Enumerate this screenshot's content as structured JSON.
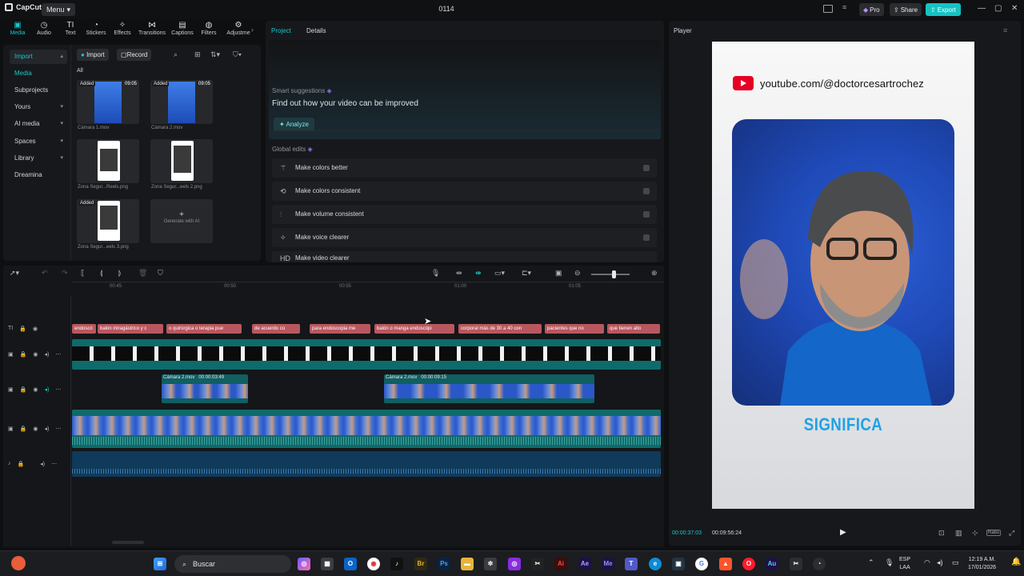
{
  "titlebar": {
    "app_name": "CapCut",
    "menu_label": "Menu",
    "project_title": "0114",
    "pro_label": "Pro",
    "share_label": "Share",
    "export_label": "Export"
  },
  "toolbar": {
    "tools": [
      {
        "label": "Media",
        "icon": "media-icon",
        "active": true
      },
      {
        "label": "Audio",
        "icon": "audio-icon"
      },
      {
        "label": "Text",
        "icon": "text-icon"
      },
      {
        "label": "Stickers",
        "icon": "stickers-icon"
      },
      {
        "label": "Effects",
        "icon": "effects-icon"
      },
      {
        "label": "Transitions",
        "icon": "transitions-icon"
      },
      {
        "label": "Captions",
        "icon": "captions-icon"
      },
      {
        "label": "Filters",
        "icon": "filters-icon"
      },
      {
        "label": "Adjustme",
        "icon": "adjustment-icon"
      }
    ]
  },
  "sidebar": {
    "items": [
      {
        "label": "Import",
        "selected": true,
        "chevron": true
      },
      {
        "label": "Media",
        "accent": true
      },
      {
        "label": "Subprojects"
      },
      {
        "label": "Yours",
        "chevron": true
      },
      {
        "label": "AI media",
        "chevron": true
      },
      {
        "label": "Spaces",
        "chevron": true
      },
      {
        "label": "Library",
        "chevron": true
      },
      {
        "label": "Dreamina"
      }
    ]
  },
  "media": {
    "import_label": "Import",
    "record_label": "Record",
    "filter_all": "All",
    "items": [
      {
        "name": "Cámara 1.mov",
        "badge": "Added",
        "duration": "09:05"
      },
      {
        "name": "Cámara 2.mov",
        "badge": "Added",
        "duration": "09:05"
      },
      {
        "name": "Zona Segur...Reels.png",
        "badge": ""
      },
      {
        "name": "Zona Segur...eels 2.png",
        "badge": ""
      },
      {
        "name": "Zona Segur...eels 3.png",
        "badge": "Added"
      }
    ],
    "generate_label": "Generate with AI"
  },
  "details": {
    "tab_project": "Project",
    "tab_details": "Details",
    "smart_title": "Smart suggestions",
    "smart_subtitle": "Find out how your video can be improved",
    "analyze_label": "Analyze",
    "global_edits_title": "Global edits",
    "edits": [
      {
        "label": "Make colors better",
        "icon": "magic-wand-icon"
      },
      {
        "label": "Make colors consistent",
        "icon": "color-sync-icon"
      },
      {
        "label": "Make volume consistent",
        "icon": "equalizer-icon"
      },
      {
        "label": "Make voice clearer",
        "icon": "sparkle-icon"
      },
      {
        "label": "Make video clearer",
        "icon": "hd-icon"
      }
    ]
  },
  "player": {
    "title": "Player",
    "youtube_handle": "youtube.com/@doctorcesartrochez",
    "caption": "SIGNIFICA",
    "current_time": "00:00:37:03",
    "total_time": "00:09:56:24",
    "ratio_label": "Ratio"
  },
  "timeline": {
    "ruler": [
      "00:45",
      "00:50",
      "00:55",
      "01:00",
      "01:05"
    ],
    "text_clips": [
      "endoscó",
      "balón intragástrico y c",
      "o quirúrgica o terapia pue",
      "de acuerdo co",
      "para endoscopia me",
      "balón o manga endoscópi",
      "corporal más de 30 a 40 con",
      "pacientes que no",
      "que tienen alto"
    ],
    "clip_a_label": "Cámara 2.mov   00:00:03:49",
    "clip_b_label": "Cámara 2.mov   00:00:09:15"
  },
  "taskbar": {
    "search_placeholder": "Buscar",
    "lang_1": "ESP",
    "lang_2": "LAA",
    "time": "12:19 A.M.",
    "date": "17/01/2026"
  },
  "colors": {
    "accent": "#18c8c8",
    "caption_blue": "#1ea2e8",
    "text_clip": "#b9575e",
    "track_teal": "#0f6b6b"
  }
}
